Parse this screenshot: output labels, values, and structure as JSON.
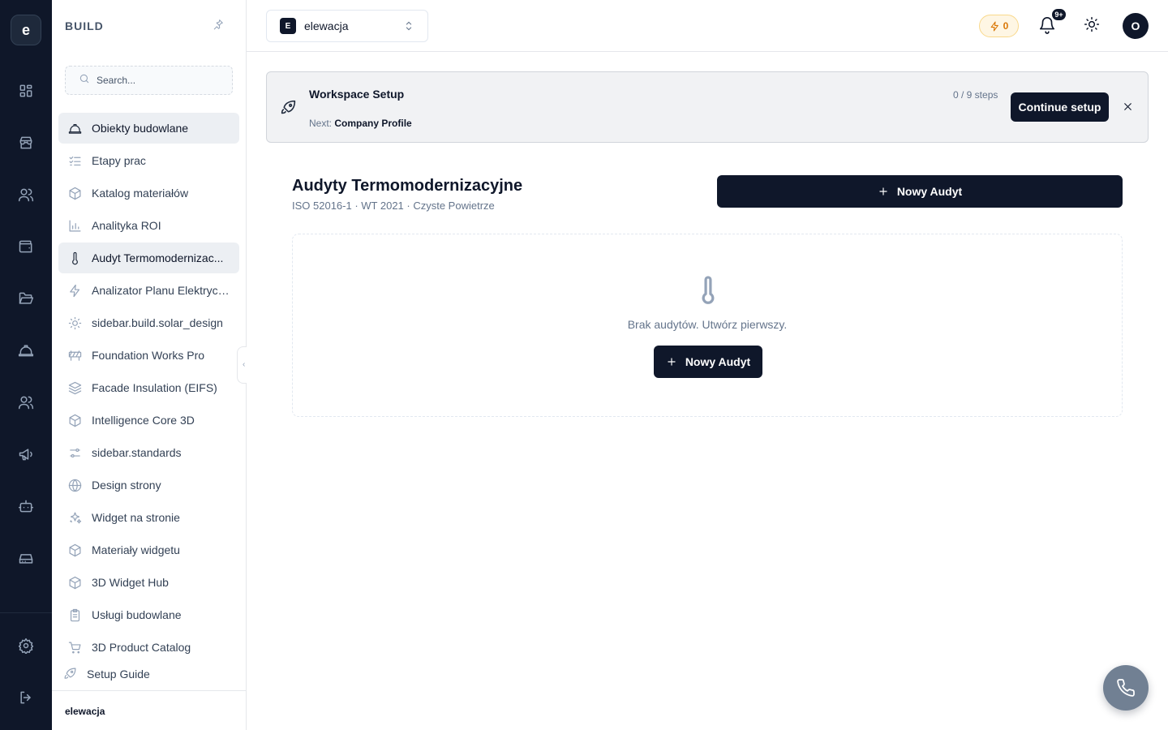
{
  "rail": {
    "logo_letter": "e",
    "items": [
      {
        "icon": "dashboard-grid-icon"
      },
      {
        "icon": "store-icon"
      },
      {
        "icon": "users-icon"
      },
      {
        "icon": "wallet-icon"
      },
      {
        "icon": "folder-open-icon"
      },
      {
        "icon": "hard-hat-icon"
      },
      {
        "icon": "team-icon"
      },
      {
        "icon": "megaphone-icon"
      },
      {
        "icon": "bot-icon"
      },
      {
        "icon": "hard-drive-icon"
      },
      {
        "icon": "settings-gear-icon"
      },
      {
        "icon": "logout-icon"
      }
    ]
  },
  "sidebar": {
    "section_title": "BUILD",
    "search_placeholder": "Search...",
    "items": [
      {
        "label": "Obiekty budowlane",
        "icon": "hard-hat-icon",
        "active": true
      },
      {
        "label": "Etapy prac",
        "icon": "checklist-icon"
      },
      {
        "label": "Katalog materiałów",
        "icon": "box-icon"
      },
      {
        "label": "Analityka ROI",
        "icon": "bar-chart-icon"
      },
      {
        "label": "Audyt Termomodernizac...",
        "icon": "thermometer-icon",
        "active": true
      },
      {
        "label": "Analizator Planu Elektrycz...",
        "icon": "lightning-icon"
      },
      {
        "label": "sidebar.build.solar_design",
        "icon": "sun-icon"
      },
      {
        "label": "Foundation Works Pro",
        "icon": "barrier-icon"
      },
      {
        "label": "Facade Insulation (EIFS)",
        "icon": "layers-icon"
      },
      {
        "label": "Intelligence Core 3D",
        "icon": "box-icon"
      },
      {
        "label": "sidebar.standards",
        "icon": "sliders-icon"
      },
      {
        "label": "Design strony",
        "icon": "globe-icon"
      },
      {
        "label": "Widget na stronie",
        "icon": "sparkles-icon"
      },
      {
        "label": "Materiały widgetu",
        "icon": "box-icon"
      },
      {
        "label": "3D Widget Hub",
        "icon": "box-icon"
      },
      {
        "label": "Usługi budowlane",
        "icon": "clipboard-icon"
      },
      {
        "label": "3D Product Catalog",
        "icon": "cart-icon"
      }
    ],
    "setup_guide_label": "Setup Guide",
    "footer_workspace": "elewacja"
  },
  "topbar": {
    "workspace_badge": "E",
    "workspace_name": "elewacja",
    "credits": "0",
    "notifications_badge": "9+",
    "avatar_letter": "O"
  },
  "banner": {
    "title": "Workspace Setup",
    "next_prefix": "Next:",
    "next_step": "Company Profile",
    "steps": "0 / 9 steps",
    "continue_label": "Continue setup"
  },
  "page": {
    "title": "Audyty Termomodernizacyjne",
    "subtitle": "ISO 52016-1 · WT 2021 · Czyste Powietrze",
    "new_audit_label": "Nowy Audyt",
    "empty_message": "Brak audytów. Utwórz pierwszy.",
    "empty_button_label": "Nowy Audyt"
  },
  "colors": {
    "rail_bg": "#0f1729",
    "primary": "#0f172a",
    "accent_credits": "#d97706",
    "fab": "#718093"
  }
}
